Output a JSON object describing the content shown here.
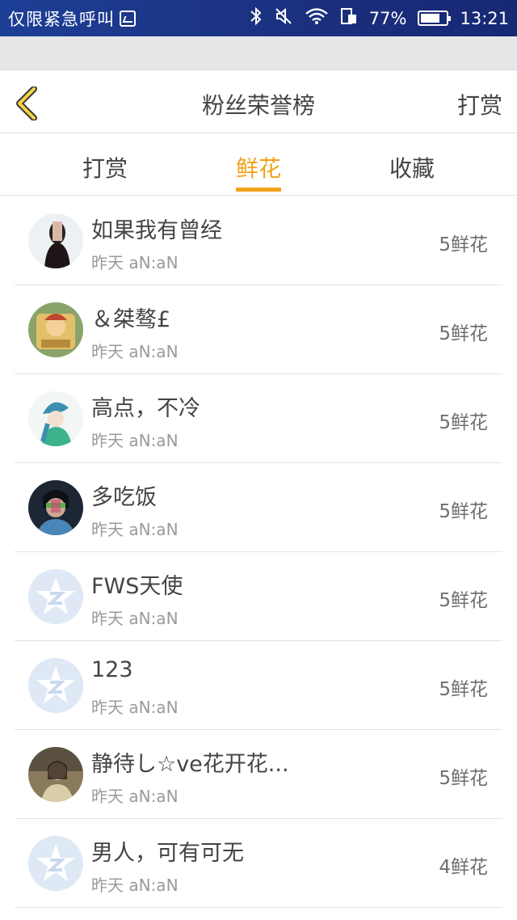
{
  "status_bar": {
    "carrier_text": "仅限紧急呼叫",
    "battery_percent": "77%",
    "battery_level": 0.77,
    "time": "13:21",
    "icons": [
      "bluetooth-icon",
      "mute-icon",
      "wifi-icon",
      "sim-icon",
      "battery-icon"
    ]
  },
  "header": {
    "title": "粉丝荣誉榜",
    "right_action": "打赏",
    "back_icon": "chevron-left-icon"
  },
  "tabs": [
    {
      "label": "打赏",
      "active": false
    },
    {
      "label": "鲜花",
      "active": true
    },
    {
      "label": "收藏",
      "active": false
    }
  ],
  "colors": {
    "accent": "#f0a21a",
    "status_bar": "#1b2f7e"
  },
  "rows": [
    {
      "name": "如果我有曾经",
      "time": "昨天 aN:aN",
      "amount": "5鲜花",
      "avatar": "photo-avatar"
    },
    {
      "name": "＆桀骜£",
      "time": "昨天 aN:aN",
      "amount": "5鲜花",
      "avatar": "photo-avatar"
    },
    {
      "name": "高点，不冷",
      "time": "昨天 aN:aN",
      "amount": "5鲜花",
      "avatar": "photo-avatar"
    },
    {
      "name": "多吃饭",
      "time": "昨天 aN:aN",
      "amount": "5鲜花",
      "avatar": "photo-avatar"
    },
    {
      "name": "FWS天使",
      "time": "昨天 aN:aN",
      "amount": "5鲜花",
      "avatar": "default-star-avatar"
    },
    {
      "name": "123",
      "time": "昨天 aN:aN",
      "amount": "5鲜花",
      "avatar": "default-star-avatar"
    },
    {
      "name": "静待し☆ve花开花...",
      "time": "昨天 aN:aN",
      "amount": "5鲜花",
      "avatar": "photo-avatar"
    },
    {
      "name": "男人，可有可无",
      "time": "昨天 aN:aN",
      "amount": "4鲜花",
      "avatar": "default-star-avatar"
    }
  ]
}
